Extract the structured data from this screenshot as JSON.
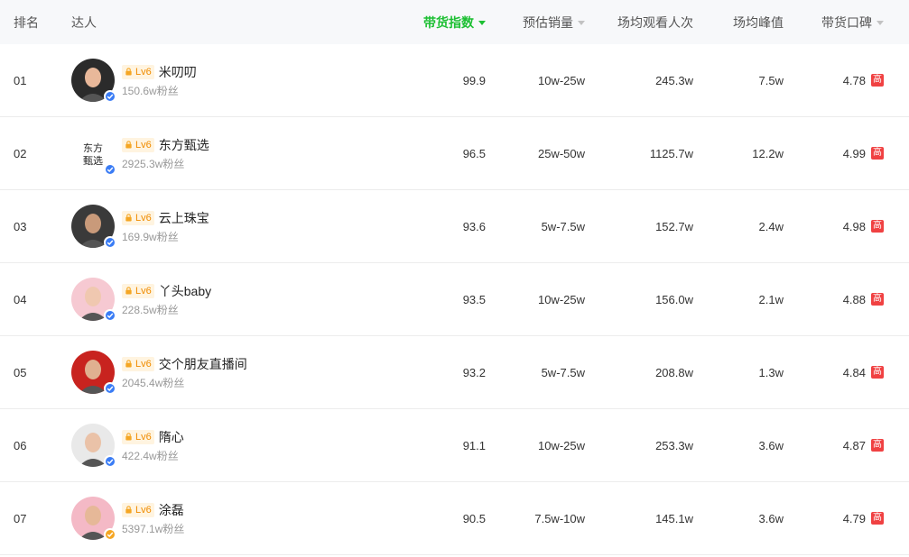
{
  "header": {
    "rank": "排名",
    "talent": "达人",
    "index": "带货指数",
    "sales": "预估销量",
    "views": "场均观看人次",
    "peak": "场均峰值",
    "reputation": "带货口碑"
  },
  "rows": [
    {
      "rank": "01",
      "level": "Lv6",
      "name": "米叨叨",
      "fans": "150.6w粉丝",
      "index": "99.9",
      "sales": "10w-25w",
      "views": "245.3w",
      "peak": "7.5w",
      "rep": "4.78",
      "tag": "高",
      "verify_color": "#3a7cf5",
      "avatar_bg": "#2b2b2b",
      "avatar_face": "#e8b89a"
    },
    {
      "rank": "02",
      "level": "Lv6",
      "name": "东方甄选",
      "fans": "2925.3w粉丝",
      "index": "96.5",
      "sales": "25w-50w",
      "views": "1125.7w",
      "peak": "12.2w",
      "rep": "4.99",
      "tag": "高",
      "verify_color": "#3a7cf5",
      "avatar_bg": "#ffffff",
      "avatar_face": "#222222",
      "avatar_logo": "东方\n甄选"
    },
    {
      "rank": "03",
      "level": "Lv6",
      "name": "云上珠宝",
      "fans": "169.9w粉丝",
      "index": "93.6",
      "sales": "5w-7.5w",
      "views": "152.7w",
      "peak": "2.4w",
      "rep": "4.98",
      "tag": "高",
      "verify_color": "#3a7cf5",
      "avatar_bg": "#3a3a3a",
      "avatar_face": "#c99a7a"
    },
    {
      "rank": "04",
      "level": "Lv6",
      "name": "丫头baby",
      "fans": "228.5w粉丝",
      "index": "93.5",
      "sales": "10w-25w",
      "views": "156.0w",
      "peak": "2.1w",
      "rep": "4.88",
      "tag": "高",
      "verify_color": "#3a7cf5",
      "avatar_bg": "#f6c9d2",
      "avatar_face": "#f0c8b0"
    },
    {
      "rank": "05",
      "level": "Lv6",
      "name": "交个朋友直播间",
      "fans": "2045.4w粉丝",
      "index": "93.2",
      "sales": "5w-7.5w",
      "views": "208.8w",
      "peak": "1.3w",
      "rep": "4.84",
      "tag": "高",
      "verify_color": "#3a7cf5",
      "avatar_bg": "#c8231f",
      "avatar_face": "#e0b090"
    },
    {
      "rank": "06",
      "level": "Lv6",
      "name": "隋心",
      "fans": "422.4w粉丝",
      "index": "91.1",
      "sales": "10w-25w",
      "views": "253.3w",
      "peak": "3.6w",
      "rep": "4.87",
      "tag": "高",
      "verify_color": "#3a7cf5",
      "avatar_bg": "#e9e9e9",
      "avatar_face": "#eac2a8"
    },
    {
      "rank": "07",
      "level": "Lv6",
      "name": "涂磊",
      "fans": "5397.1w粉丝",
      "index": "90.5",
      "sales": "7.5w-10w",
      "views": "145.1w",
      "peak": "3.6w",
      "rep": "4.79",
      "tag": "高",
      "verify_color": "#f5a623",
      "avatar_bg": "#f4b9c6",
      "avatar_face": "#e6b898"
    }
  ],
  "colors": {
    "accent": "#1cbf32",
    "badge_text": "#f08c00",
    "tag_high": "#f04142"
  }
}
